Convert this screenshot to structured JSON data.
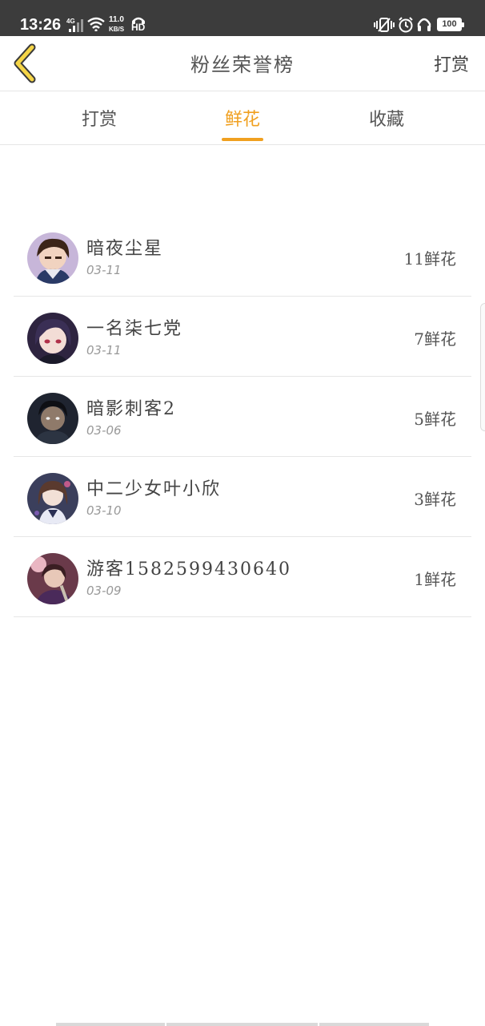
{
  "status_bar": {
    "time": "13:26",
    "network": "4G",
    "speed_value": "11.0",
    "speed_unit": "KB/S",
    "hd": "HD",
    "battery": "100"
  },
  "header": {
    "title": "粉丝荣誉榜",
    "action_label": "打赏",
    "back_icon": "chevron-left-icon",
    "accent_color": "#f5d547"
  },
  "tabs": [
    {
      "label": "打赏",
      "active": false
    },
    {
      "label": "鲜花",
      "active": true
    },
    {
      "label": "收藏",
      "active": false
    }
  ],
  "accent_color": "#f0a020",
  "fans": [
    {
      "name": "暗夜尘星",
      "date": "03-11",
      "count": "11鲜花"
    },
    {
      "name": "一名柒七党",
      "date": "03-11",
      "count": "7鲜花"
    },
    {
      "name": "暗影刺客2",
      "date": "03-06",
      "count": "5鲜花"
    },
    {
      "name": "中二少女叶小欣",
      "date": "03-10",
      "count": "3鲜花"
    },
    {
      "name": "游客1582599430640",
      "date": "03-09",
      "count": "1鲜花"
    }
  ]
}
